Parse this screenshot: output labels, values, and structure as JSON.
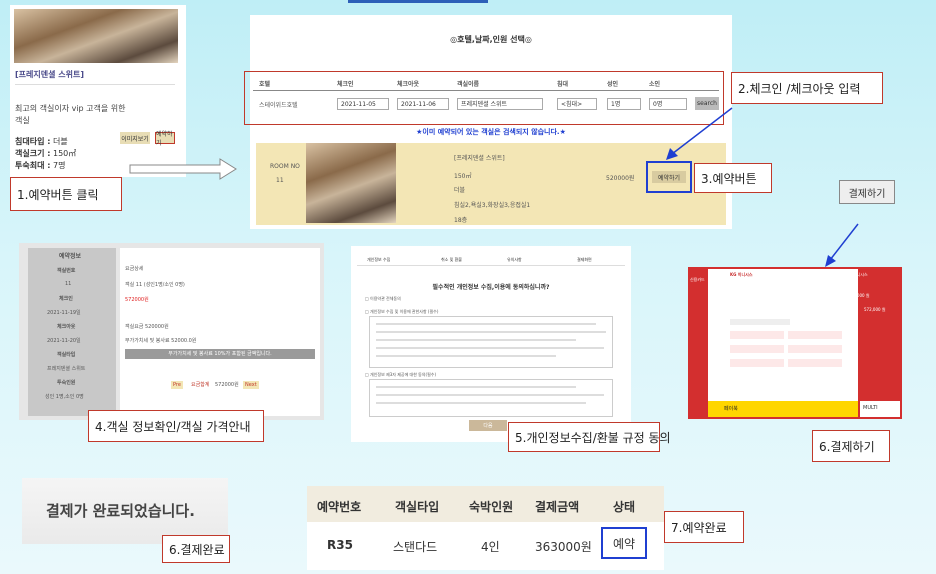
{
  "hotel_card": {
    "name": "[프레지덴셜 스위트]",
    "desc_line1": "최고의 객실이자 vip 고객을 위한",
    "desc_line2": "객실",
    "bed_label": "침대타입 :",
    "bed_value": "더블",
    "size_label": "객실크기 :",
    "size_value": "150㎡",
    "max_label": "투숙최대 :",
    "max_value": "7명",
    "image_btn": "이미지보기",
    "reserve_btn": "예약하기"
  },
  "search": {
    "title": "◎호텔,날짜,인원 선택◎",
    "headers": [
      "호텔",
      "체크인",
      "체크아웃",
      "객실이름",
      "침대",
      "성인",
      "소인"
    ],
    "hotel_value": "스테이위드호텔",
    "checkin": "2021-11-05",
    "checkout": "2021-11-06",
    "room_name": "프레지덴셜 스위트",
    "bed": "<침대>",
    "adult": "1명",
    "child": "0명",
    "search_btn": "search",
    "notice": "★이미 예약되어 있는 객실은 검색되지 않습니다.★"
  },
  "result": {
    "room_no_label": "ROOM NO",
    "room_no": "11",
    "name": "[프레지덴셜 스위트]",
    "size": "150㎡",
    "bed": "더블",
    "rooms": "침실2,욕실3,화장실3,응접실1",
    "age": "18층",
    "price": "520000원",
    "reserve_btn": "예약하기"
  },
  "callouts": {
    "c1": "1.예약버튼 클릭",
    "c2": "2.체크인 /체크아웃 입력",
    "c3": "3.예약버튼",
    "c4": "4.객실 정보확인/객실 가격안내",
    "c5": "5.개인정보수집/환불 규정 동의",
    "c6a": "6.결제하기",
    "c6b": "6.결제완료",
    "c7": "7.예약완료",
    "pay_button": "결제하기"
  },
  "booking_info": {
    "title": "예약정보",
    "rows": [
      {
        "label": "객실번호",
        "value": "11"
      },
      {
        "label": "체크인",
        "value": "2021-11-19일"
      },
      {
        "label": "체크아웃",
        "value": "2021-11-20일"
      },
      {
        "label": "객실타입",
        "value": "프레지덴셜 스위트"
      },
      {
        "label": "투숙인원",
        "value": "성인 1명,소인 0명"
      }
    ],
    "fee_title": "요금상세",
    "fee_line": "객실 11 (성인1명/소인 0명)",
    "fee_price": "572000원",
    "room_charge": "객실요금 520000원",
    "tax": "부가가치세 및 봉사료 52000.0원",
    "tax_note": "부가가치세 및 봉사료 10%가 포함된 금액입니다.",
    "prev": "Pre",
    "total_label": "요금합계",
    "total": "572000원",
    "next": "Next"
  },
  "consent": {
    "tabs": [
      "개인정보 수집",
      "취소 및 환불",
      "유의사항",
      "결제화면"
    ],
    "heading": "필수적인 개인정보 수집,이용에 동의하십니까?",
    "all_agree": "□ 이용약관 전체동의",
    "section1": "□ 개인정보 수집 및 이용에 관한사항 (필수)",
    "section2": "□ 개인정보 제3자 제공에 대한 동의(필수)",
    "next_btn": "다음"
  },
  "payment": {
    "brand": "KG 이니시스",
    "side_label": "신용카드",
    "total": "572,000 원",
    "banner_left": "페이북",
    "banner_right": "MULTI"
  },
  "complete": {
    "message": "결제가 완료되었습니다."
  },
  "reservation_table": {
    "headers": [
      "예약번호",
      "객실타입",
      "숙박인원",
      "결제금액",
      "상태"
    ],
    "row": [
      "R35",
      "스탠다드",
      "4인",
      "363000원",
      "예약"
    ]
  },
  "colors": {
    "accent_red": "#c0392b",
    "accent_blue": "#1f3fd1",
    "beige": "#f3e6b5",
    "pay_red": "#d32f2f"
  }
}
